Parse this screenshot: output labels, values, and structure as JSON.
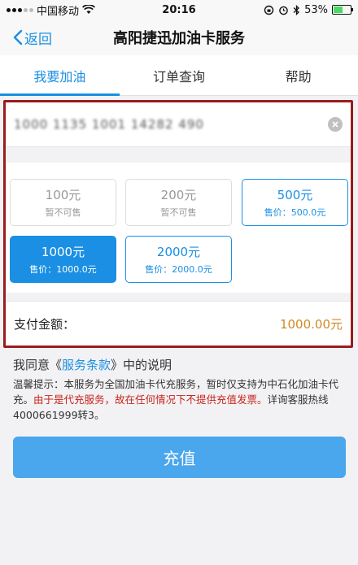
{
  "status_bar": {
    "carrier": "中国移动",
    "time": "20:16",
    "battery": "53%",
    "battery_level": 0.53
  },
  "nav": {
    "back_label": "返回",
    "title": "高阳捷迅加油卡服务"
  },
  "tabs": [
    {
      "label": "我要加油",
      "active": true
    },
    {
      "label": "订单查询",
      "active": false
    },
    {
      "label": "帮助",
      "active": false
    }
  ],
  "card_input": {
    "value": "1000 1135 1001 14282 490"
  },
  "options": [
    {
      "amount": "100元",
      "sub": "暂不可售"
    },
    {
      "amount": "200元",
      "sub": "暂不可售"
    },
    {
      "amount": "500元",
      "sub": "售价：500.0元"
    },
    {
      "amount": "1000元",
      "sub": "售价：1000.0元"
    },
    {
      "amount": "2000元",
      "sub": "售价：2000.0元"
    }
  ],
  "payment": {
    "label": "支付金额：",
    "amount": "1000.00元"
  },
  "agreement": {
    "prefix": "我同意《",
    "link": "服务条款",
    "suffix": "》中的说明"
  },
  "notice": {
    "text1": "温馨提示：本服务为全国加油卡代充服务，暂时仅支持为中石化加油卡代充。",
    "red": "由于是代充服务，故在任何情况下不提供充值发票。",
    "text2": "详询客服热线4000661999转3。"
  },
  "submit_label": "充值",
  "colors": {
    "accent": "#1a8fe3",
    "price": "#d08a25",
    "warning": "#c8241c",
    "highlight_border": "#9b1c1c",
    "button": "#4aa6ed"
  }
}
